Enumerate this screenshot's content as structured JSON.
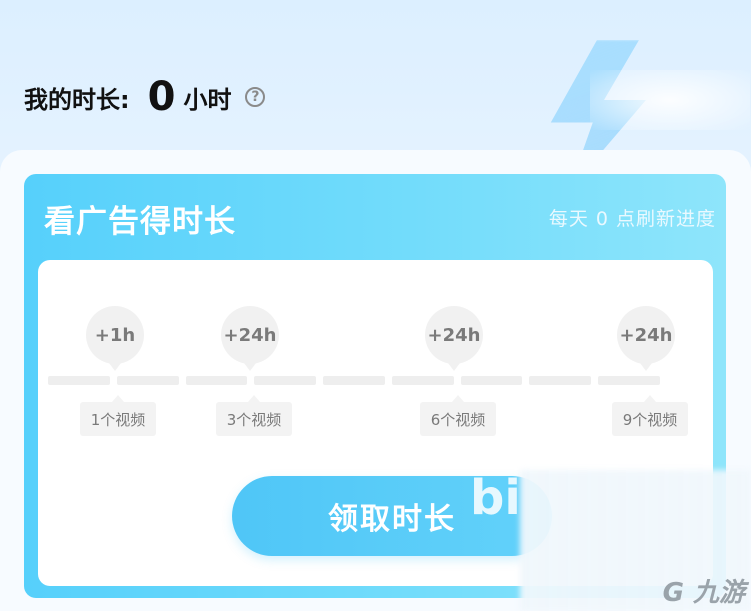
{
  "header": {
    "label": "我的时长:",
    "hours_value": "0",
    "hours_unit": "小时",
    "help_glyph": "?"
  },
  "card": {
    "title": "看广告得时长",
    "subtitle": "每天 0 点刷新进度",
    "milestones": [
      {
        "reward": "+1h",
        "requirement": "1个视频"
      },
      {
        "reward": "+24h",
        "requirement": "3个视频"
      },
      {
        "reward": "+24h",
        "requirement": "6个视频"
      },
      {
        "reward": "+24h",
        "requirement": "9个视频"
      }
    ],
    "progress_videos_watched": 0,
    "progress_segments": 9,
    "claim_label": "领取时长"
  },
  "watermark": {
    "bili_text": "bi",
    "site_text": "九游"
  },
  "colors": {
    "accent": "#56d0fb",
    "button": "#4fc6f7",
    "muted_text": "#7a7a7a"
  }
}
